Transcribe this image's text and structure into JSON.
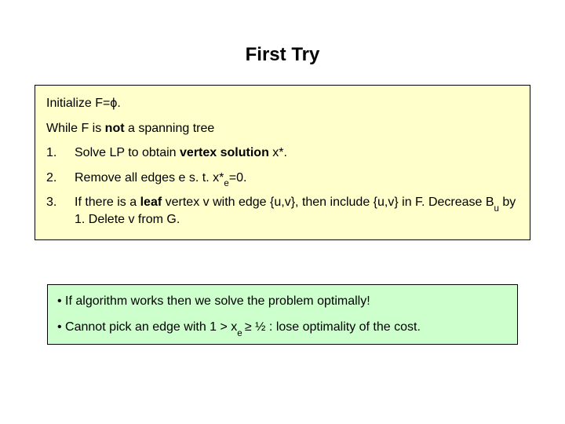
{
  "slide": {
    "title": "First Try",
    "algorithm": {
      "init_prefix": "Initialize F=",
      "init_phi": "ϕ",
      "init_suffix": ".",
      "while_prefix": "While F is ",
      "while_not": "not",
      "while_suffix": " a spanning tree",
      "steps": [
        {
          "num": "1.",
          "prefix": "Solve LP to obtain ",
          "bold": "vertex solution",
          "suffix": " x*."
        },
        {
          "num": "2.",
          "prefix": " Remove all edges e s. t. x*",
          "sub": "e",
          "suffix": "=0."
        },
        {
          "num": "3.",
          "p1": "If there is a ",
          "b1": "leaf",
          "p2": " vertex v with edge {u,v}, then include {u,v} in F. Decrease B",
          "sub": "u",
          "p3": " by 1. Delete v from G."
        }
      ]
    },
    "notes": {
      "n1": "• If algorithm works then we solve the problem optimally!",
      "n2_p1": "• Cannot pick an edge with 1 > x",
      "n2_sub": "e ",
      "n2_ge": "≥",
      "n2_p2": " ½ : lose  optimality of the cost."
    }
  }
}
